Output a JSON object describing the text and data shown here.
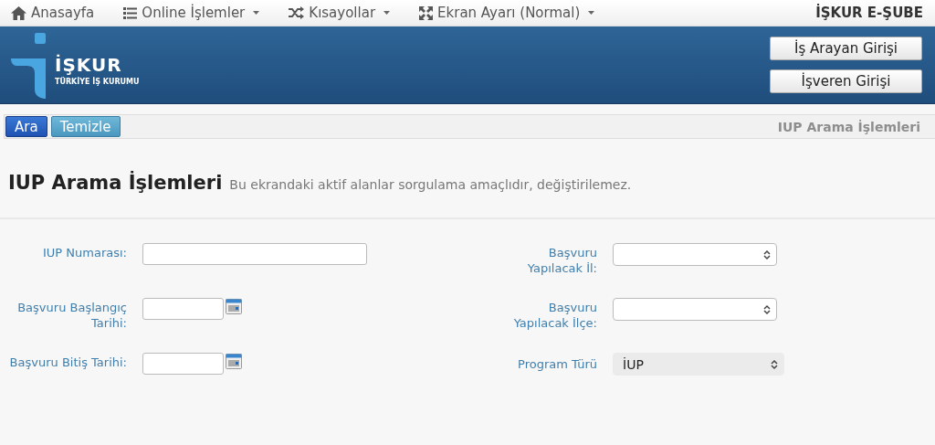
{
  "top_nav": {
    "items": [
      {
        "label": "Anasayfa",
        "dropdown": false
      },
      {
        "label": "Online İşlemler",
        "dropdown": true
      },
      {
        "label": "Kısayollar",
        "dropdown": true
      },
      {
        "label": "Ekran Ayarı (Normal)",
        "dropdown": true
      }
    ],
    "brand": "İŞKUR E-ŞUBE"
  },
  "banner": {
    "logo_name": "İŞKUR",
    "logo_subtitle": "TÜRKİYE İŞ KURUMU",
    "buttons": [
      "İş Arayan Girişi",
      "İşveren Girişi"
    ]
  },
  "toolbar": {
    "buttons": [
      {
        "label": "Ara",
        "kind": "primary"
      },
      {
        "label": "Temizle",
        "kind": "info"
      }
    ],
    "caption": "IUP Arama İşlemleri"
  },
  "page": {
    "title": "IUP Arama İşlemleri",
    "subtitle": "Bu ekrandaki aktif alanlar sorgulama amaçlıdır, değiştirilemez."
  },
  "form": {
    "left": [
      {
        "label": "IUP Numarası:",
        "kind": "text"
      },
      {
        "label": "Başvuru Başlangıç Tarihi:",
        "kind": "date"
      },
      {
        "label": "Başvuru Bitiş Tarihi:",
        "kind": "date"
      }
    ],
    "right": [
      {
        "label": "Başvuru Yapılacak İl:",
        "kind": "select",
        "disabled": false
      },
      {
        "label": "Başvuru Yapılacak İlçe:",
        "kind": "select",
        "disabled": false
      },
      {
        "label": "Program Türü",
        "kind": "select",
        "value": "İUP",
        "disabled": true
      }
    ]
  }
}
